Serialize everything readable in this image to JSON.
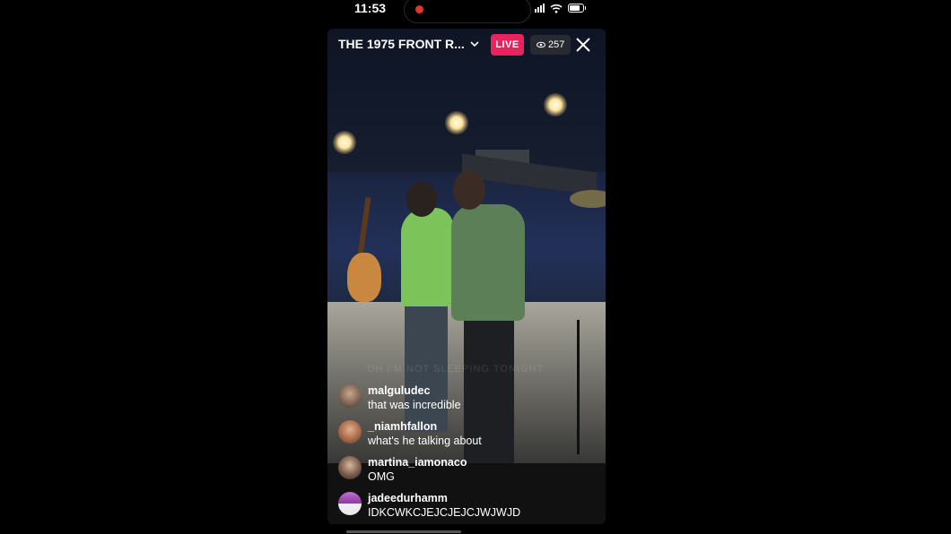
{
  "status_bar": {
    "time": "11:53",
    "recording_color": "#e8322e",
    "icons": [
      "signal-icon",
      "wifi-icon",
      "battery-icon"
    ]
  },
  "stream": {
    "title": "THE 1975 FRONT R...",
    "live_label": "LIVE",
    "viewer_count": "257",
    "accent_color": "#e8245f",
    "video_overlay_text": "OH I'M NOT SLEEPING TONIGHT"
  },
  "comments": [
    {
      "username": "malguludec",
      "message": "that was incredible",
      "avatar_color": "#8a7a6a"
    },
    {
      "username": "_niamhfallon",
      "message": "what's he talking about",
      "avatar_color": "#a86a4a"
    },
    {
      "username": "martina_iamonaco",
      "message": "OMG",
      "avatar_color": "#7a5a4a"
    },
    {
      "username": "jadeedurhamm",
      "message": "IDKCWKCJEJCJEJCJWJWJD",
      "avatar_color": "#8a3aa0"
    }
  ]
}
